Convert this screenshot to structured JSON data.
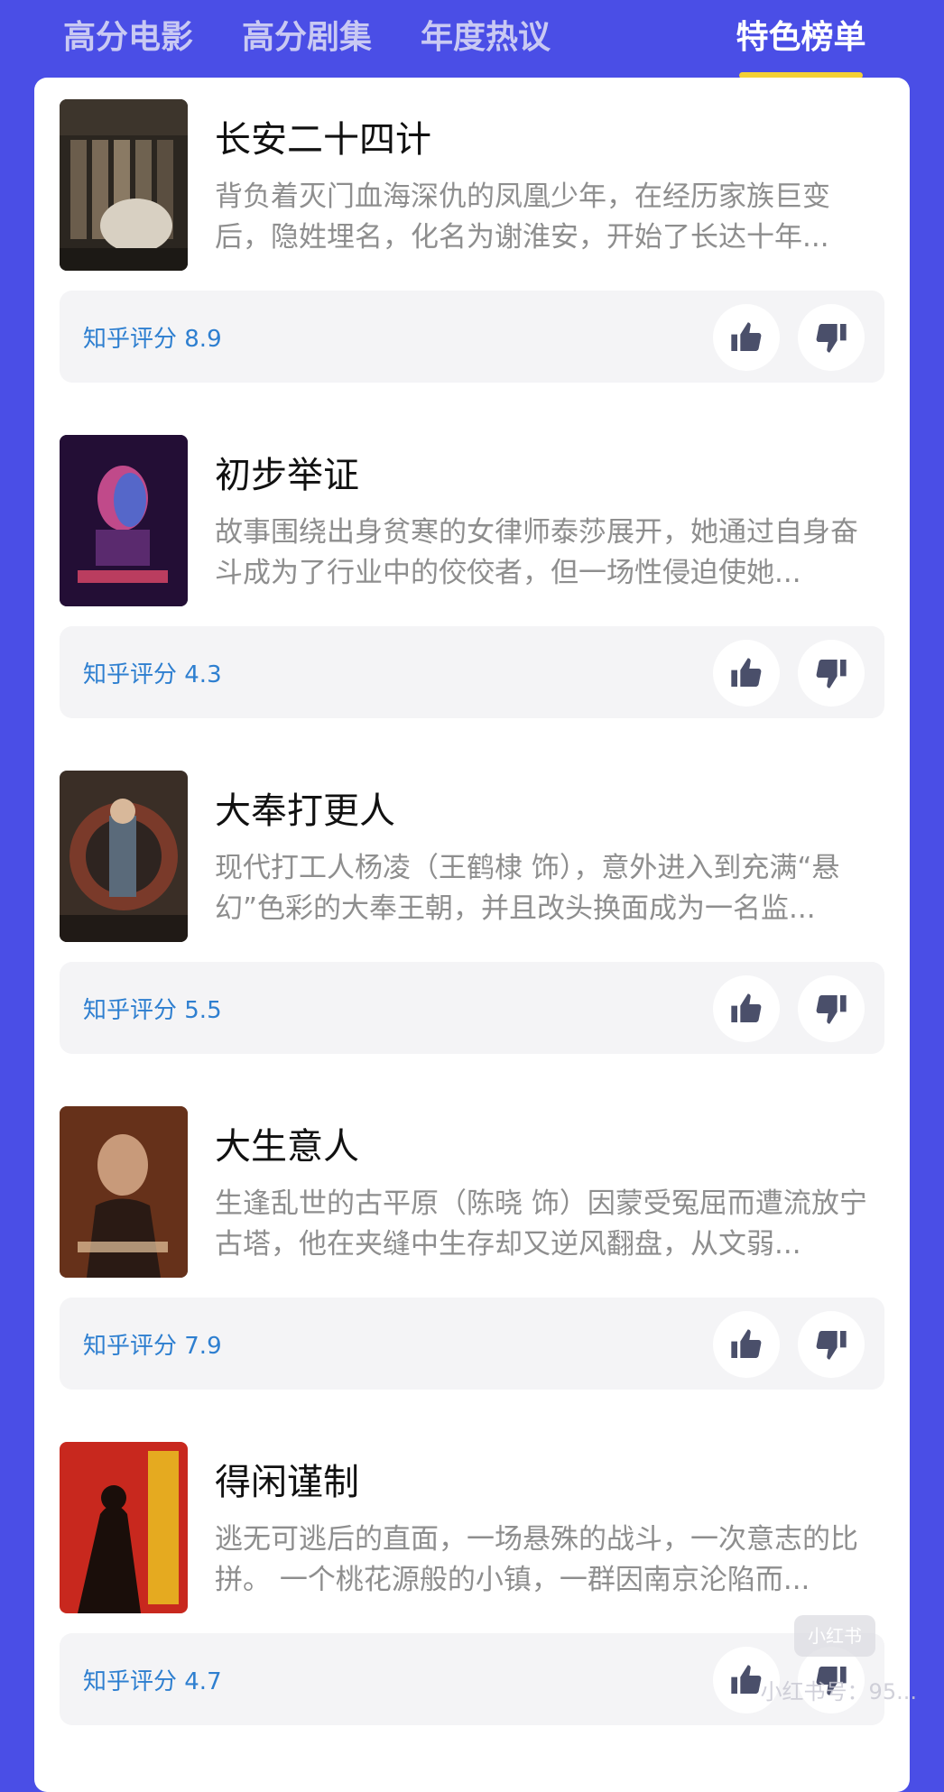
{
  "tabs": [
    "高分电影",
    "高分剧集",
    "年度热议",
    "特色榜单"
  ],
  "active_tab": "特色榜单",
  "colors": {
    "background": "#4a4ee6",
    "accent_underline": "#f4d034",
    "rating_text": "#2e7fd0"
  },
  "items": [
    {
      "title": "长安二十四计",
      "description": "背负着灭门血海深仇的凤凰少年，在经历家族巨变后，隐姓埋名，化名为谢淮安，开始了长达十年...",
      "rating_label": "知乎评分 8.9"
    },
    {
      "title": "初步举证",
      "description": "故事围绕出身贫寒的女律师泰莎展开，她通过自身奋斗成为了行业中的佼佼者，但一场性侵迫使她...",
      "rating_label": "知乎评分 4.3"
    },
    {
      "title": "大奉打更人",
      "description": "现代打工人杨凌（王鹤棣 饰），意外进入到充满“悬幻”色彩的大奉王朝，并且改头换面成为一名监...",
      "rating_label": "知乎评分 5.5"
    },
    {
      "title": "大生意人",
      "description": "生逢乱世的古平原（陈晓 饰）因蒙受冤屈而遭流放宁古塔，他在夹缝中生存却又逆风翻盘，从文弱...",
      "rating_label": "知乎评分 7.9"
    },
    {
      "title": "得闲谨制",
      "description": "逃无可逃后的直面，一场悬殊的战斗，一次意志的比拼。 一个桃花源般的小镇，一群因南京沦陷而...",
      "rating_label": "知乎评分 4.7"
    }
  ],
  "icons": {
    "like": "thumbs-up-icon",
    "dislike": "thumbs-down-icon"
  },
  "watermark": {
    "logo_text": "小红书",
    "text": "小红书号：95..."
  }
}
